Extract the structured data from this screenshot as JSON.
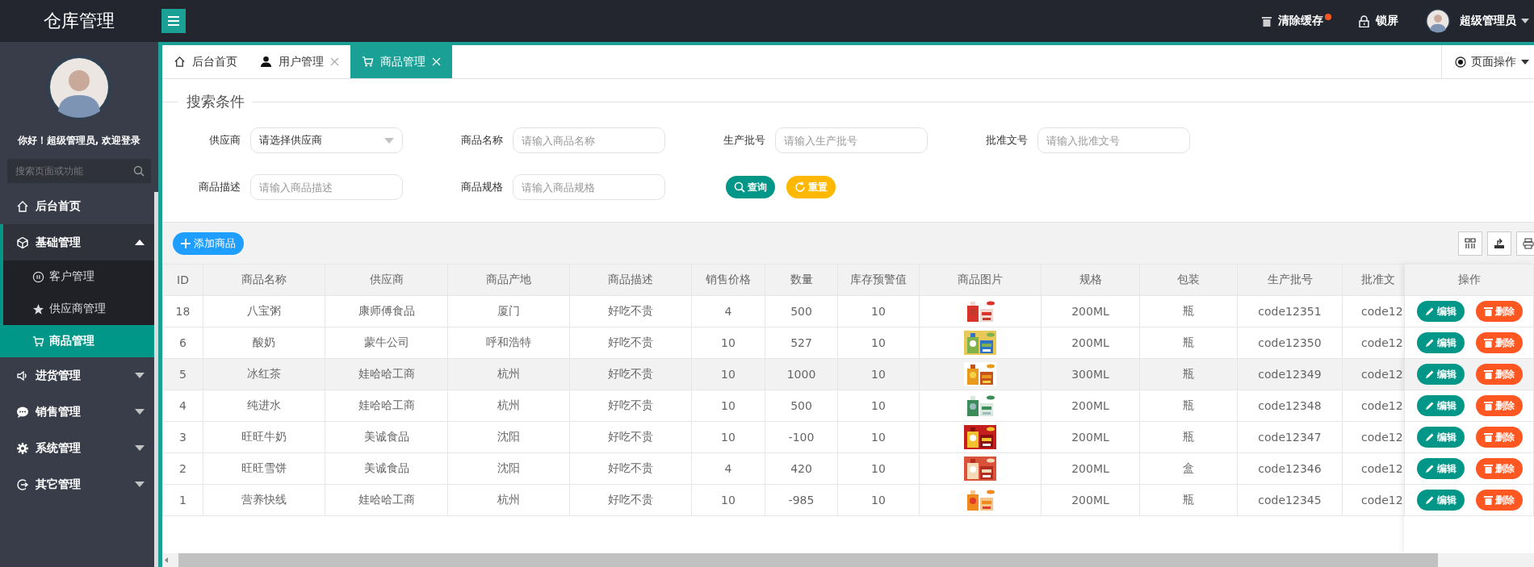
{
  "app": {
    "title": "仓库管理"
  },
  "header_actions": [
    {
      "label": "清除缓存",
      "has_notification": true
    },
    {
      "label": "锁屏",
      "has_notification": false
    }
  ],
  "user_menu": {
    "name": "超级管理员"
  },
  "sidebar": {
    "welcome": "你好！超级管理员, 欢迎登录",
    "search": {
      "placeholder": "搜索页面或功能"
    },
    "items": [
      {
        "label": "后台首页",
        "selected": false
      },
      {
        "label": "基础管理",
        "selected": false,
        "expanded": true,
        "children": [
          {
            "label": "客户管理",
            "selected": false
          },
          {
            "label": "供应商管理",
            "selected": false
          },
          {
            "label": "商品管理",
            "selected": true
          }
        ]
      },
      {
        "label": "进货管理",
        "selected": false,
        "expanded": false
      },
      {
        "label": "销售管理",
        "selected": false,
        "expanded": false
      },
      {
        "label": "系统管理",
        "selected": false,
        "expanded": false
      },
      {
        "label": "其它管理",
        "selected": false,
        "expanded": false
      }
    ]
  },
  "tabs": [
    {
      "label": "后台首页",
      "closable": false,
      "selected": false
    },
    {
      "label": "用户管理",
      "closable": true,
      "selected": false
    },
    {
      "label": "商品管理",
      "closable": true,
      "selected": true
    }
  ],
  "page_actions": {
    "label": "页面操作"
  },
  "search": {
    "legend": "搜索条件",
    "fields": [
      {
        "label": "供应商",
        "kind": "select",
        "value": "请选择供应商"
      },
      {
        "label": "商品名称",
        "kind": "text",
        "placeholder": "请输入商品名称"
      },
      {
        "label": "生产批号",
        "kind": "text",
        "placeholder": "请输入生产批号"
      },
      {
        "label": "批准文号",
        "kind": "text",
        "placeholder": "请输入批准文号"
      },
      {
        "label": "商品描述",
        "kind": "text",
        "placeholder": "请输入商品描述"
      },
      {
        "label": "商品规格",
        "kind": "text",
        "placeholder": "请输入商品规格"
      }
    ],
    "buttons": [
      {
        "label": "查询",
        "kind": "search"
      },
      {
        "label": "重置",
        "kind": "reset"
      }
    ]
  },
  "toolbar": {
    "add_button": "添加商品"
  },
  "table": {
    "columns": [
      "ID",
      "商品名称",
      "供应商",
      "商品产地",
      "商品描述",
      "销售价格",
      "数量",
      "库存预警值",
      "商品图片",
      "规格",
      "包装",
      "生产批号",
      "批准文"
    ],
    "action_column": "操作",
    "rows": [
      {
        "hovered": false,
        "cells": [
          "18",
          "八宝粥",
          "康师傅食品",
          "厦门",
          "好吃不贵",
          "4",
          "500",
          "10",
          {
            "kind": "picture"
          },
          "200ML",
          "瓶",
          "code12351",
          "code12"
        ],
        "actions": [
          {
            "label": "编辑",
            "kind": "edit"
          },
          {
            "label": "删除",
            "kind": "delete"
          }
        ]
      },
      {
        "hovered": false,
        "cells": [
          "6",
          "酸奶",
          "蒙牛公司",
          "呼和浩特",
          "好吃不贵",
          "10",
          "527",
          "10",
          {
            "kind": "picture"
          },
          "200ML",
          "瓶",
          "code12350",
          "code12"
        ],
        "actions": [
          {
            "label": "编辑",
            "kind": "edit"
          },
          {
            "label": "删除",
            "kind": "delete"
          }
        ]
      },
      {
        "hovered": true,
        "cells": [
          "5",
          "冰红茶",
          "娃哈哈工商",
          "杭州",
          "好吃不贵",
          "10",
          "1000",
          "10",
          {
            "kind": "picture"
          },
          "300ML",
          "瓶",
          "code12349",
          "code12"
        ],
        "actions": [
          {
            "label": "编辑",
            "kind": "edit"
          },
          {
            "label": "删除",
            "kind": "delete"
          }
        ]
      },
      {
        "hovered": false,
        "cells": [
          "4",
          "纯进水",
          "娃哈哈工商",
          "杭州",
          "好吃不贵",
          "10",
          "500",
          "10",
          {
            "kind": "picture"
          },
          "200ML",
          "瓶",
          "code12348",
          "code12"
        ],
        "actions": [
          {
            "label": "编辑",
            "kind": "edit"
          },
          {
            "label": "删除",
            "kind": "delete"
          }
        ]
      },
      {
        "hovered": false,
        "cells": [
          "3",
          "旺旺牛奶",
          "美诚食品",
          "沈阳",
          "好吃不贵",
          "10",
          "-100",
          "10",
          {
            "kind": "picture"
          },
          "200ML",
          "瓶",
          "code12347",
          "code12"
        ],
        "actions": [
          {
            "label": "编辑",
            "kind": "edit"
          },
          {
            "label": "删除",
            "kind": "delete"
          }
        ]
      },
      {
        "hovered": false,
        "cells": [
          "2",
          "旺旺雪饼",
          "美诚食品",
          "沈阳",
          "好吃不贵",
          "4",
          "420",
          "10",
          {
            "kind": "picture"
          },
          "200ML",
          "盒",
          "code12346",
          "code12"
        ],
        "actions": [
          {
            "label": "编辑",
            "kind": "edit"
          },
          {
            "label": "删除",
            "kind": "delete"
          }
        ]
      },
      {
        "hovered": false,
        "cells": [
          "1",
          "营养快线",
          "娃哈哈工商",
          "杭州",
          "好吃不贵",
          "10",
          "-985",
          "10",
          {
            "kind": "picture"
          },
          "200ML",
          "瓶",
          "code12345",
          "code12"
        ],
        "actions": [
          {
            "label": "编辑",
            "kind": "edit"
          },
          {
            "label": "删除",
            "kind": "delete"
          }
        ]
      }
    ]
  }
}
